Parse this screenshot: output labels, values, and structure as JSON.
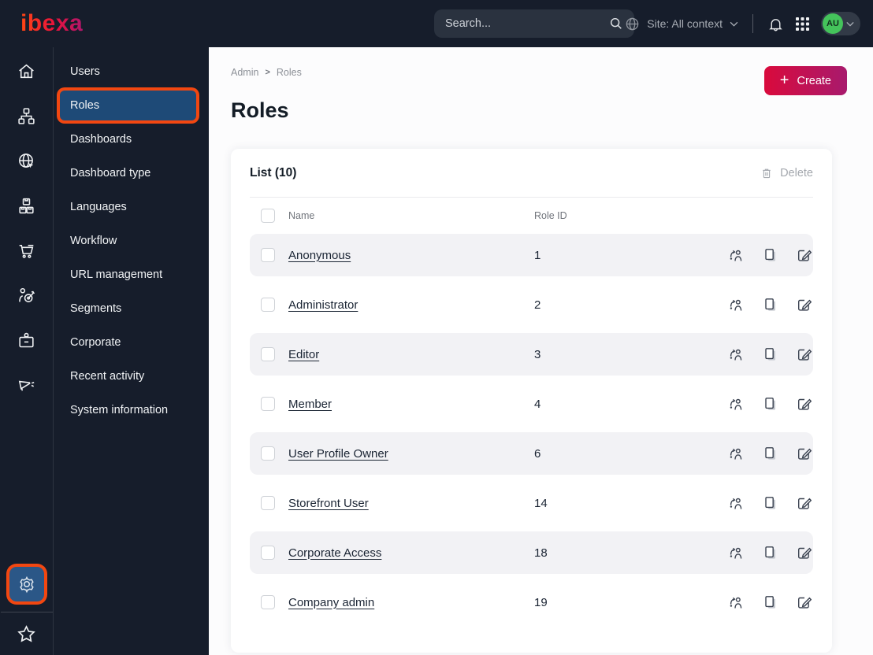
{
  "topbar": {
    "logo_text": "ibexa",
    "search_placeholder": "Search...",
    "site_context_label": "Site: All context",
    "avatar_initials": "AU"
  },
  "rail": {
    "items": [
      "home",
      "content-tree",
      "site-management",
      "product-catalog",
      "commerce",
      "personalization",
      "corporate-badge",
      "campaigns",
      "settings",
      "bookmarks"
    ],
    "active_item": "settings"
  },
  "menu": {
    "items": [
      {
        "label": "Users",
        "active": false
      },
      {
        "label": "Roles",
        "active": true
      },
      {
        "label": "Dashboards",
        "active": false
      },
      {
        "label": "Dashboard type",
        "active": false
      },
      {
        "label": "Languages",
        "active": false
      },
      {
        "label": "Workflow",
        "active": false
      },
      {
        "label": "URL management",
        "active": false
      },
      {
        "label": "Segments",
        "active": false
      },
      {
        "label": "Corporate",
        "active": false
      },
      {
        "label": "Recent activity",
        "active": false
      },
      {
        "label": "System information",
        "active": false
      }
    ]
  },
  "page": {
    "breadcrumb": [
      "Admin",
      "Roles"
    ],
    "title": "Roles",
    "create_label": "Create"
  },
  "list": {
    "title": "List (10)",
    "delete_label": "Delete",
    "columns": {
      "name": "Name",
      "role_id": "Role ID"
    },
    "row_actions": [
      "assign",
      "copy",
      "edit"
    ],
    "rows": [
      {
        "name": "Anonymous",
        "role_id": "1"
      },
      {
        "name": "Administrator",
        "role_id": "2"
      },
      {
        "name": "Editor",
        "role_id": "3"
      },
      {
        "name": "Member",
        "role_id": "4"
      },
      {
        "name": "User Profile Owner",
        "role_id": "6"
      },
      {
        "name": "Storefront User",
        "role_id": "14"
      },
      {
        "name": "Corporate Access",
        "role_id": "18"
      },
      {
        "name": "Company admin",
        "role_id": "19"
      }
    ]
  },
  "colors": {
    "topbar_bg": "#161d2b",
    "annotation_highlight": "#f24711",
    "active_menu_blue": "#1e4a77",
    "active_rail_blue": "#2b5787",
    "create_gradient_start": "#d90a3c",
    "create_gradient_end": "#a81a6d",
    "logo_gradient_start": "#ff4713",
    "logo_gradient_end": "#b0176c",
    "avatar_green": "#44c35b",
    "row_alt_bg": "#f2f2f5"
  }
}
